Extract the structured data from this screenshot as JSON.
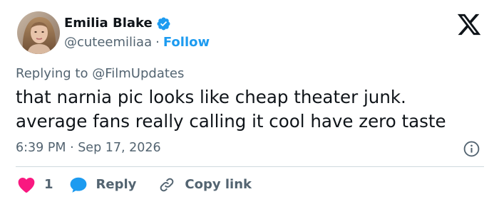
{
  "author": {
    "display_name": "Emilia Blake",
    "handle": "@cuteemiliaa",
    "separator": "·",
    "follow_label": "Follow",
    "verified": true
  },
  "icons": {
    "logo": "x-logo-icon",
    "verified": "verified-badge-icon",
    "info": "info-icon",
    "like": "heart-icon",
    "reply": "reply-bubble-icon",
    "copy": "link-icon"
  },
  "reply_context": {
    "prefix": "Replying to",
    "mention": "@FilmUpdates"
  },
  "tweet": {
    "lines": [
      "that narnia pic looks like cheap theater junk.",
      "average fans really calling it cool have zero taste"
    ],
    "timestamp": "6:39 PM · Sep 17, 2026"
  },
  "actions": {
    "like_count": "1",
    "reply_label": "Reply",
    "copy_label": "Copy link"
  },
  "colors": {
    "accent": "#1d9bf0",
    "heart": "#f91880",
    "text": "#0f1419",
    "secondary": "#536471",
    "divider": "#cfd9de"
  }
}
